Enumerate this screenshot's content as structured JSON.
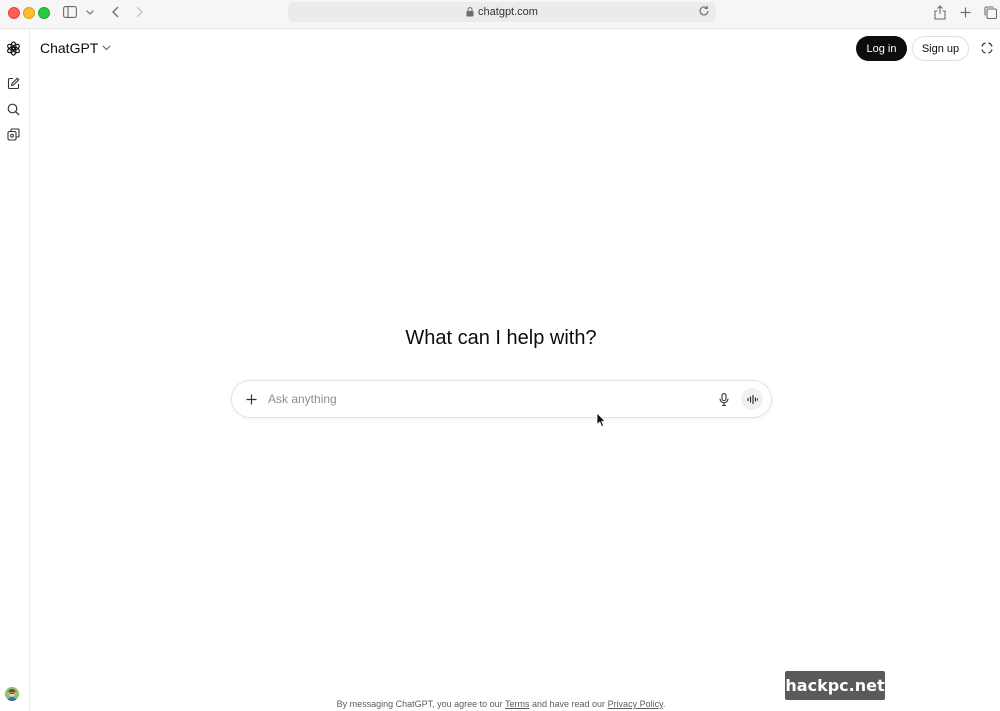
{
  "browser": {
    "url": "chatgpt.com",
    "icons": [
      "sidebar-toggle-icon",
      "chevron-down-icon",
      "back-icon",
      "forward-icon",
      "lock-icon",
      "reload-icon",
      "share-icon",
      "new-tab-icon",
      "tab-overview-icon"
    ]
  },
  "rail": {
    "icons": [
      "openai-logo-icon",
      "new-chat-icon",
      "search-icon",
      "library-icon"
    ]
  },
  "header": {
    "model_name": "ChatGPT",
    "login_label": "Log in",
    "signup_label": "Sign up"
  },
  "main": {
    "heading": "What can I help with?",
    "composer": {
      "placeholder": "Ask anything",
      "value": ""
    }
  },
  "footer": {
    "prefix": "By messaging ChatGPT, you agree to our ",
    "terms_label": "Terms",
    "middle": " and have read our ",
    "privacy_label": "Privacy Policy",
    "suffix": "."
  },
  "watermark": {
    "text": "hackpc.net"
  },
  "colors": {
    "primary_button_bg": "#0d0d0d",
    "text": "#0d0d0d",
    "muted_text": "#5d5d5d",
    "border": "#e3e3e3"
  }
}
